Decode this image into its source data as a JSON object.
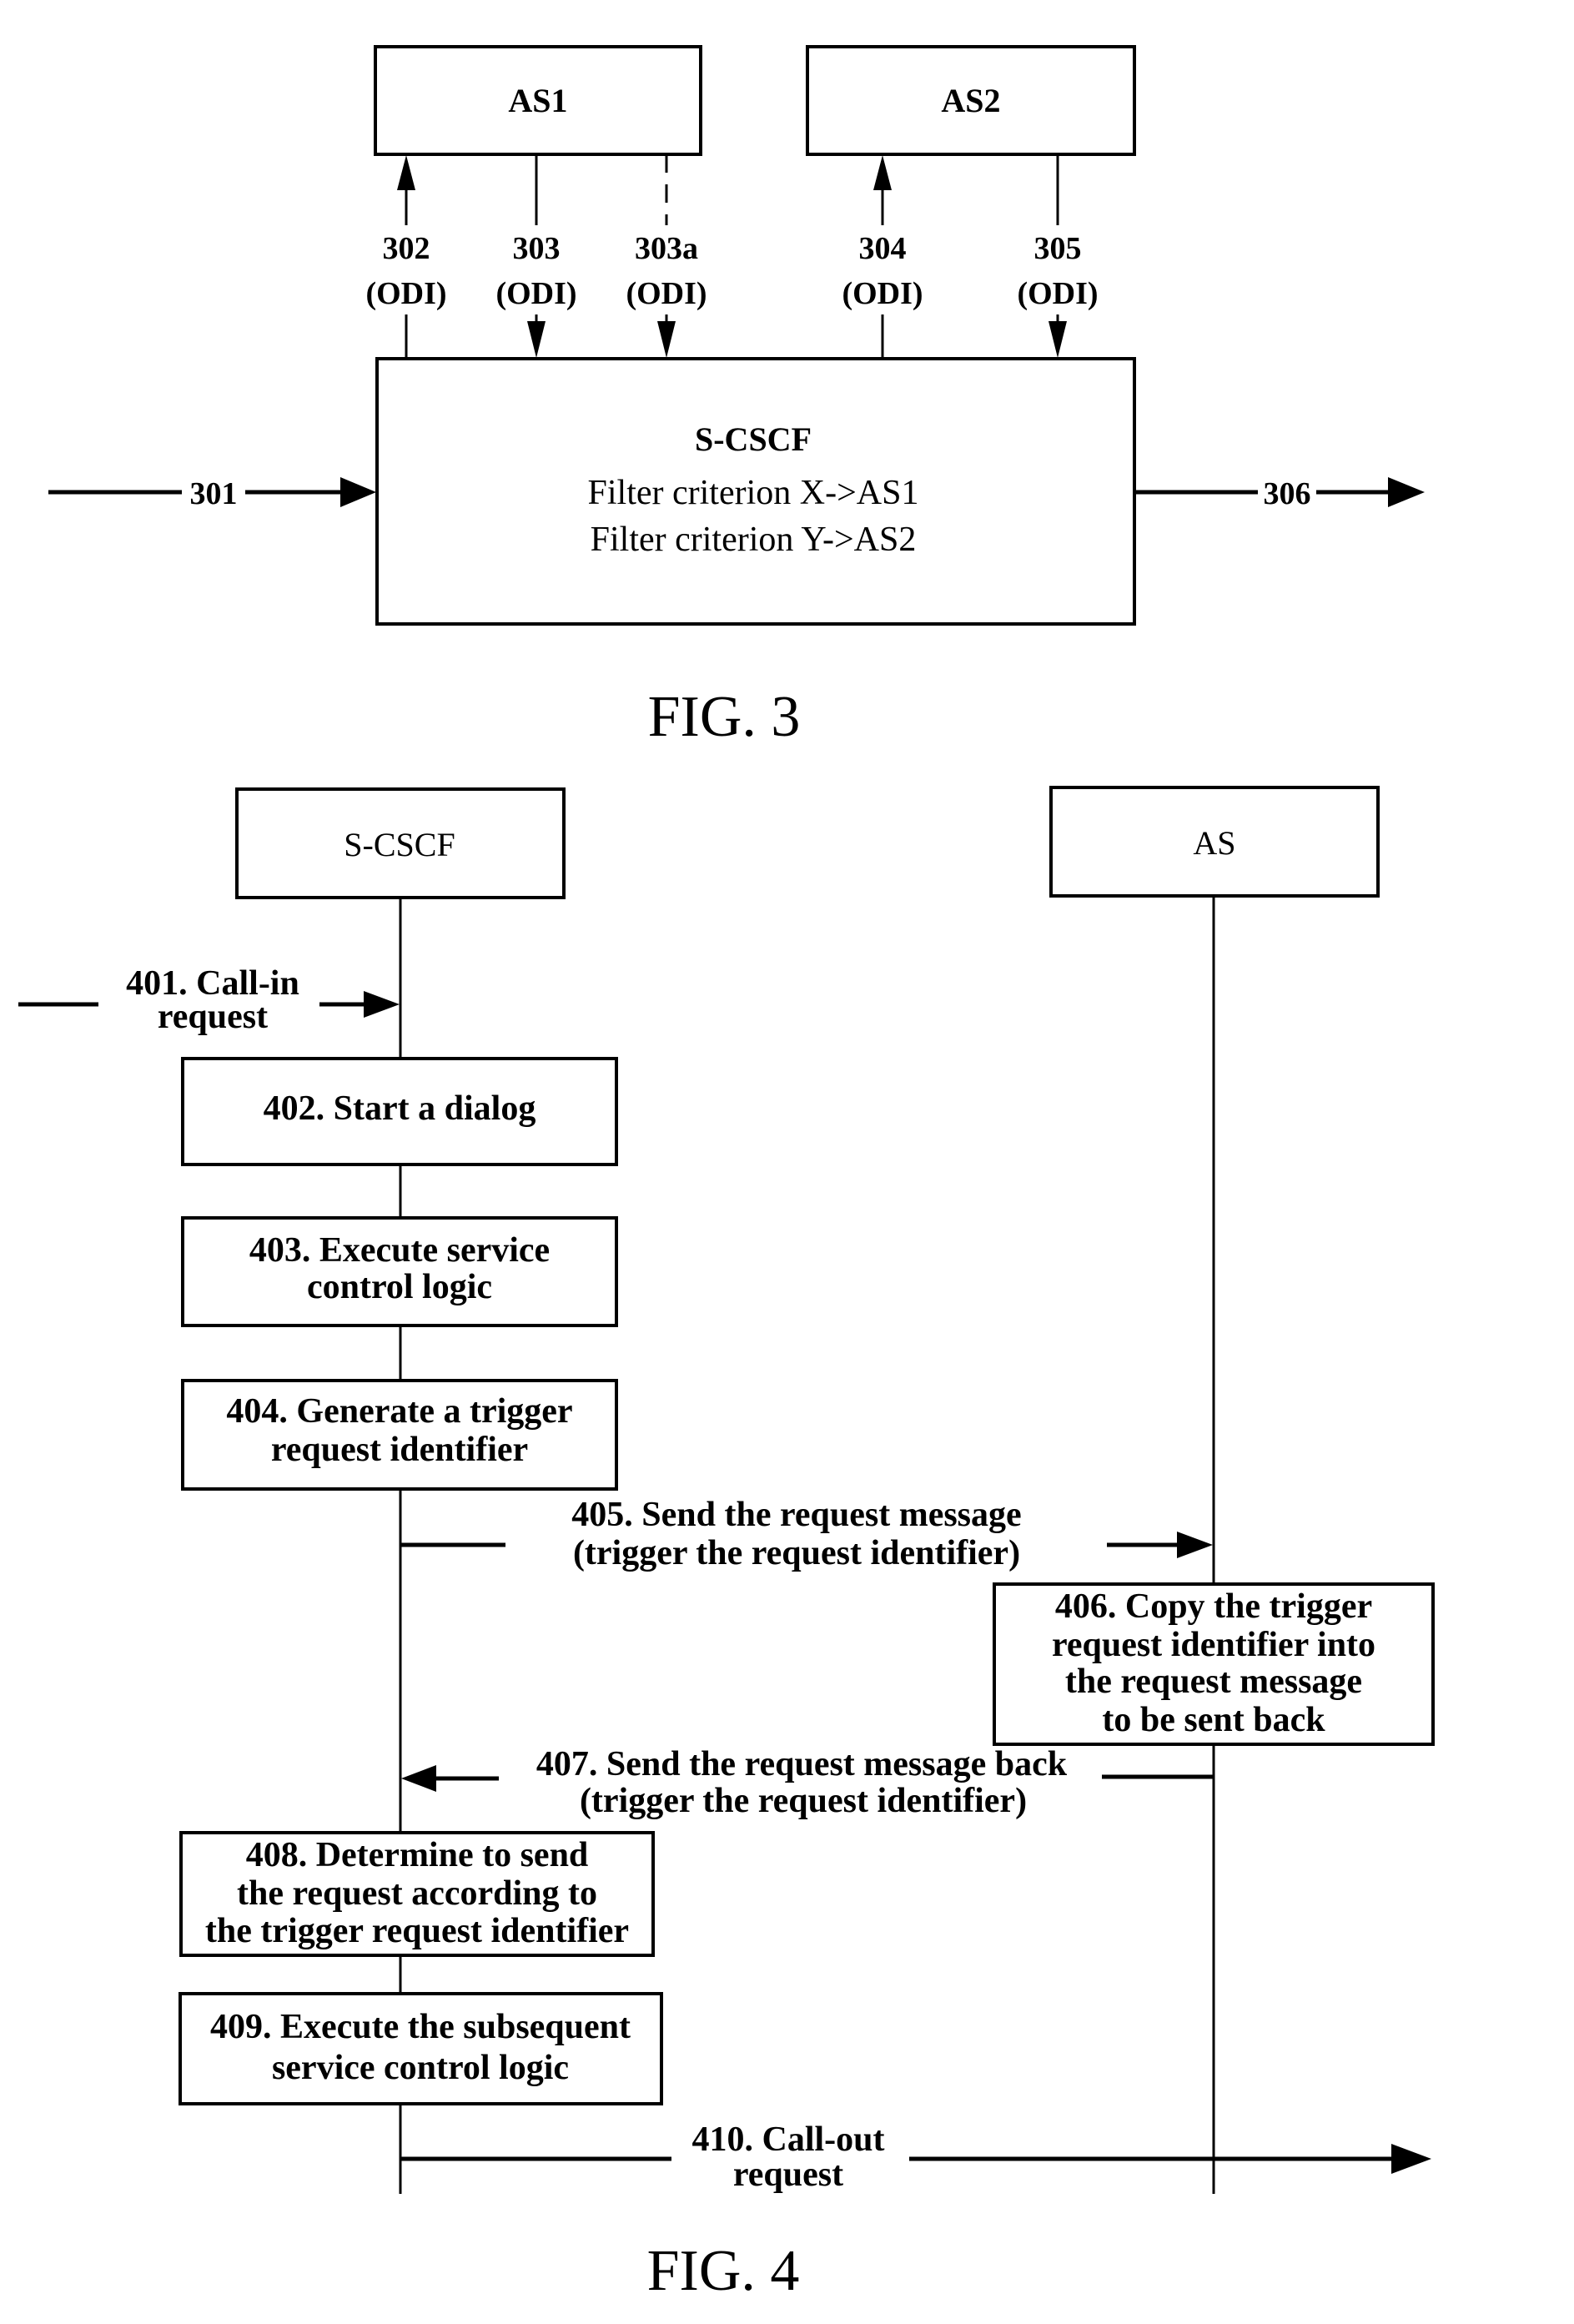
{
  "fig3": {
    "caption": "FIG. 3",
    "nodes": {
      "as1": "AS1",
      "as2": "AS2",
      "scscf": {
        "title": "S-CSCF",
        "lines": [
          "Filter criterion X->AS1",
          "Filter criterion Y->AS2"
        ]
      }
    },
    "connectors": [
      {
        "id": "302",
        "label": "302",
        "sub": "(ODI)",
        "direction": "to AS1",
        "style": "solid"
      },
      {
        "id": "303",
        "label": "303",
        "sub": "(ODI)",
        "direction": "to S-CSCF",
        "style": "solid"
      },
      {
        "id": "303a",
        "label": "303a",
        "sub": "(ODI)",
        "direction": "to S-CSCF",
        "style": "dashed"
      },
      {
        "id": "304",
        "label": "304",
        "sub": "(ODI)",
        "direction": "to AS2",
        "style": "solid"
      },
      {
        "id": "305",
        "label": "305",
        "sub": "(ODI)",
        "direction": "to S-CSCF",
        "style": "solid"
      }
    ],
    "incoming": {
      "label": "301"
    },
    "outgoing": {
      "label": "306"
    }
  },
  "fig4": {
    "caption": "FIG. 4",
    "participants": {
      "scscf": "S-CSCF",
      "as": "AS"
    },
    "messages": {
      "m401": [
        "401. Call-in",
        "request"
      ],
      "m405": [
        "405. Send the request message",
        "(trigger the request identifier)"
      ],
      "m407": [
        "407. Send the request message back",
        "(trigger the request identifier)"
      ],
      "m410": [
        "410. Call-out",
        "request"
      ]
    },
    "steps": {
      "s402": [
        "402. Start a dialog"
      ],
      "s403": [
        "403. Execute service",
        "control logic"
      ],
      "s404": [
        "404. Generate a trigger",
        "request identifier"
      ],
      "s406": [
        "406. Copy the trigger",
        "request identifier into",
        "the request message",
        "to be sent back"
      ],
      "s408": [
        "408. Determine to send",
        "the request according to",
        "the trigger request identifier"
      ],
      "s409": [
        "409. Execute the subsequent",
        "service control logic"
      ]
    }
  }
}
